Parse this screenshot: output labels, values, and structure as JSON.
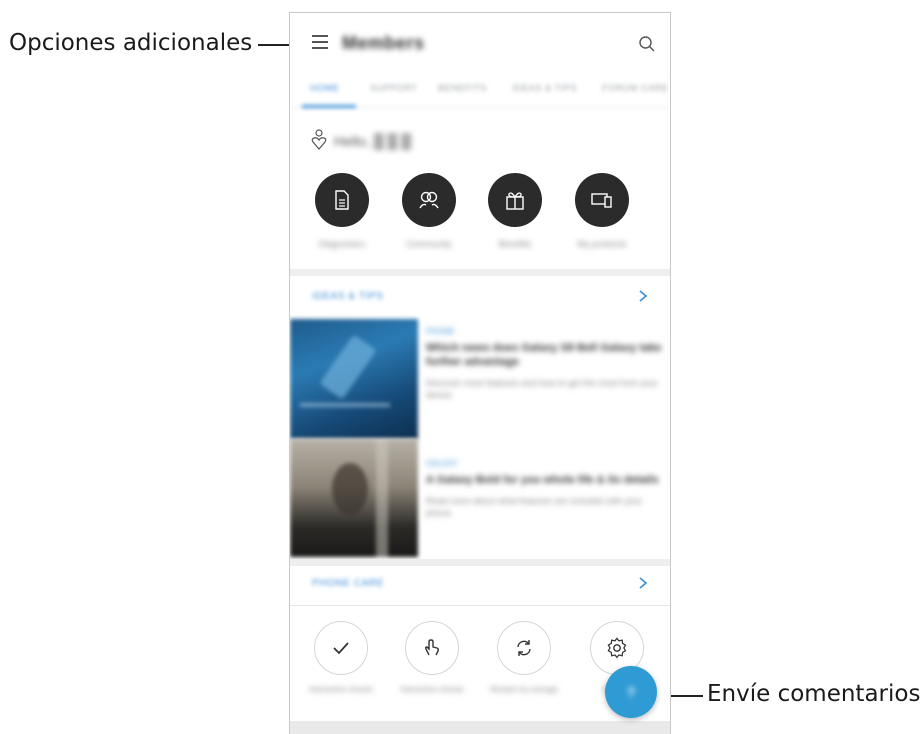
{
  "callouts": {
    "menu": "Opciones adicionales",
    "feedback": "Envíe comentarios"
  },
  "app": {
    "title": "Members",
    "tabs": [
      "HOME",
      "SUPPORT",
      "BENEFITS",
      "IDEAS & TIPS",
      "FORUM CARE"
    ],
    "active_tab": 0
  },
  "greeting": "Hello, ",
  "quick_actions": [
    {
      "label": "Diagnostics",
      "icon": "document-icon"
    },
    {
      "label": "Community",
      "icon": "people-icon"
    },
    {
      "label": "Benefits",
      "icon": "gift-icon"
    },
    {
      "label": "My products",
      "icon": "devices-icon"
    }
  ],
  "tips_section": {
    "title": "IDEAS & TIPS",
    "articles": [
      {
        "tag": "PHONE",
        "title": "Which news does Galaxy S8 Bell Galaxy take further advantage",
        "desc": "Discover more features and how to get the most from your device"
      },
      {
        "tag": "GALAXY",
        "title": "A Galaxy Bold for you whole life & its details",
        "desc": "Read more about what features are included with your phone"
      }
    ]
  },
  "tools_section": {
    "title": "PHONE CARE",
    "tools": [
      {
        "label": "Interactive checks",
        "icon": "check-icon"
      },
      {
        "label": "Interactive checks",
        "icon": "touch-icon"
      },
      {
        "label": "Restart my storage",
        "icon": "refresh-icon"
      },
      {
        "label": "Settings",
        "icon": "gear-icon"
      }
    ]
  },
  "fab_label": "?",
  "colors": {
    "accent": "#3a8fd6",
    "fab": "#2f9bd4",
    "dark_circle": "#2b2b2b"
  }
}
